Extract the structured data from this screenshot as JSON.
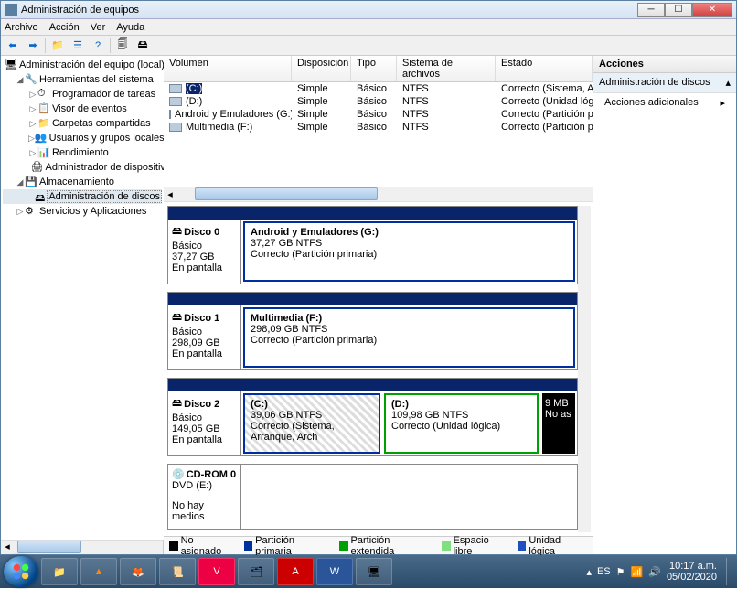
{
  "window": {
    "title": "Administración de equipos"
  },
  "menu": {
    "archivo": "Archivo",
    "accion": "Acción",
    "ver": "Ver",
    "ayuda": "Ayuda"
  },
  "toolbar_icons": [
    "back",
    "forward",
    "up",
    "props",
    "help",
    "refresh",
    "disk-tool"
  ],
  "tree": {
    "root": "Administración del equipo (local)",
    "herramientas": "Herramientas del sistema",
    "programador": "Programador de tareas",
    "visor": "Visor de eventos",
    "carpetas": "Carpetas compartidas",
    "usuarios": "Usuarios y grupos locales",
    "rendimiento": "Rendimiento",
    "dispositivos": "Administrador de dispositivos",
    "almacenamiento": "Almacenamiento",
    "discos": "Administración de discos",
    "servicios": "Servicios y Aplicaciones"
  },
  "vol_headers": {
    "volumen": "Volumen",
    "disposicion": "Disposición",
    "tipo": "Tipo",
    "sistema": "Sistema de archivos",
    "estado": "Estado"
  },
  "volumes": [
    {
      "name": "(C:)",
      "disp": "Simple",
      "tipo": "Básico",
      "fs": "NTFS",
      "estado": "Correcto (Sistema, Arranque, Archivo d"
    },
    {
      "name": "(D:)",
      "disp": "Simple",
      "tipo": "Básico",
      "fs": "NTFS",
      "estado": "Correcto (Unidad lógica)"
    },
    {
      "name": "Android y Emuladores (G:)",
      "disp": "Simple",
      "tipo": "Básico",
      "fs": "NTFS",
      "estado": "Correcto (Partición primaria)"
    },
    {
      "name": "Multimedia (F:)",
      "disp": "Simple",
      "tipo": "Básico",
      "fs": "NTFS",
      "estado": "Correcto (Partición primaria)"
    }
  ],
  "disks": [
    {
      "name": "Disco 0",
      "type": "Básico",
      "size": "37,27 GB",
      "status": "En pantalla",
      "parts": [
        {
          "title": "Android y Emuladores  (G:)",
          "size": "37,27 GB NTFS",
          "state": "Correcto (Partición primaria)",
          "kind": "primary"
        }
      ]
    },
    {
      "name": "Disco 1",
      "type": "Básico",
      "size": "298,09 GB",
      "status": "En pantalla",
      "parts": [
        {
          "title": "Multimedia  (F:)",
          "size": "298,09 GB NTFS",
          "state": "Correcto (Partición primaria)",
          "kind": "primary"
        }
      ]
    },
    {
      "name": "Disco 2",
      "type": "Básico",
      "size": "149,05 GB",
      "status": "En pantalla",
      "parts": [
        {
          "title": " (C:)",
          "size": "39,06 GB NTFS",
          "state": "Correcto (Sistema, Arranque, Arch",
          "kind": "primary-hatched"
        },
        {
          "title": " (D:)",
          "size": "109,98 GB NTFS",
          "state": "Correcto (Unidad lógica)",
          "kind": "extended"
        },
        {
          "title": "",
          "size": "9 MB",
          "state": "No as",
          "kind": "unalloc"
        }
      ]
    },
    {
      "name": "CD-ROM 0",
      "type": "DVD (E:)",
      "size": "",
      "status": "No hay medios",
      "parts": []
    }
  ],
  "legend": {
    "no_asignado": "No asignado",
    "primaria": "Partición primaria",
    "extendida": "Partición extendida",
    "libre": "Espacio libre",
    "logica": "Unidad lógica"
  },
  "legend_colors": {
    "no_asignado": "#000",
    "primaria": "#0030a0",
    "extendida": "#00a000",
    "libre": "#80e080",
    "logica": "#2050c0"
  },
  "actions": {
    "header": "Acciones",
    "item1": "Administración de discos",
    "item2": "Acciones adicionales"
  },
  "taskbar": {
    "apps": [
      "explorer",
      "vlc",
      "firefox",
      "python",
      "vivaldi",
      "files",
      "adobe",
      "word",
      "mgmt"
    ],
    "tray_lang": "ES",
    "time": "10:17 a.m.",
    "date": "05/02/2020"
  }
}
